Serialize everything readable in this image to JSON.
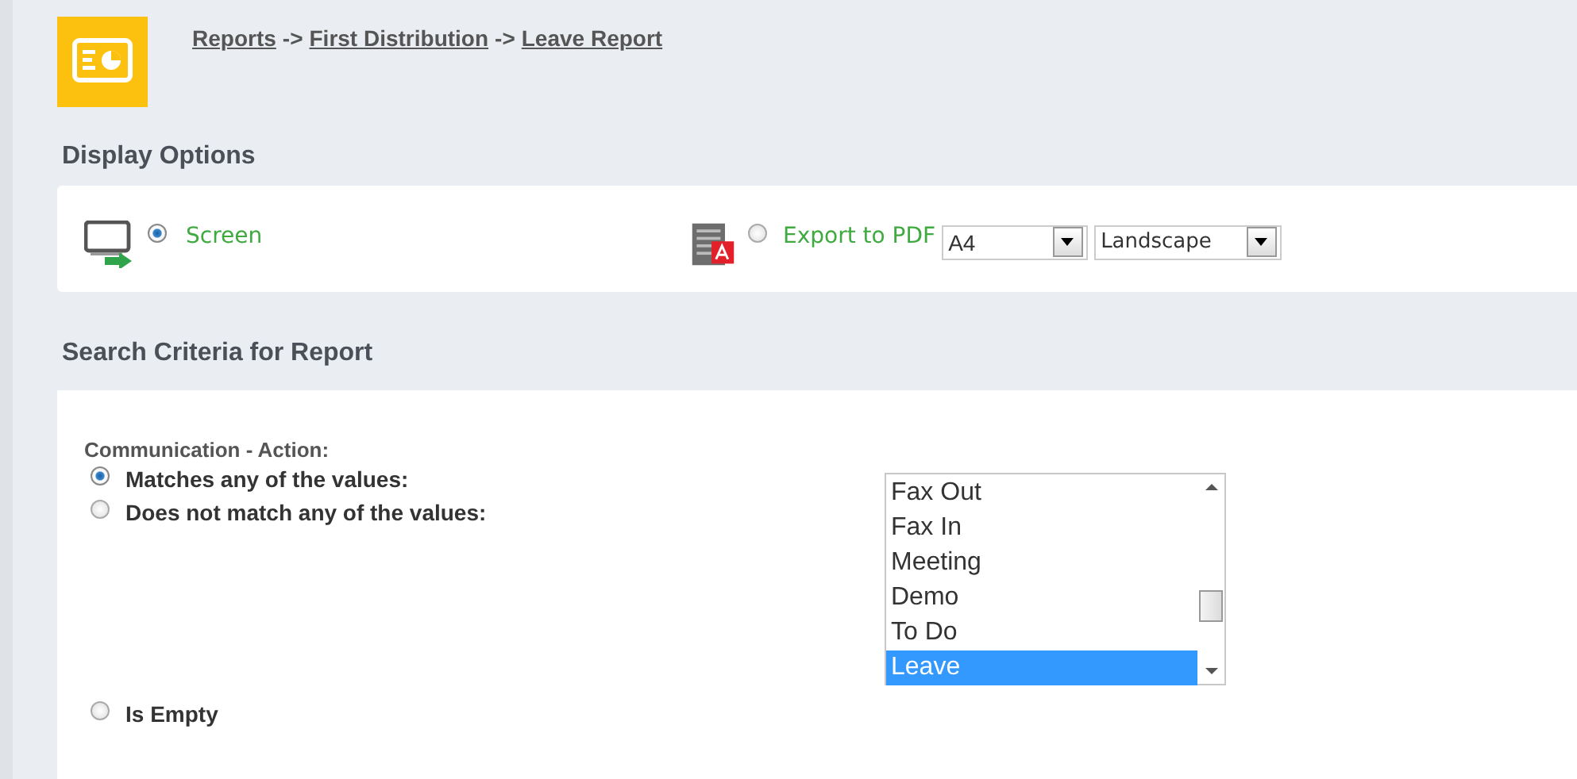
{
  "breadcrumb": [
    {
      "label": "Reports"
    },
    {
      "label": "First Distribution"
    },
    {
      "label": "Leave Report"
    }
  ],
  "breadcrumb_separator": "->",
  "display_options": {
    "title": "Display Options",
    "choices": [
      {
        "kind": "screen",
        "label": "Screen",
        "selected": true
      },
      {
        "kind": "pdf",
        "label": "Export to PDF",
        "selected": false,
        "paper": "A4",
        "orientation": "Landscape"
      }
    ]
  },
  "search_criteria": {
    "title": "Search Criteria for Report",
    "field_label": "Communication - Action:",
    "match_options": [
      {
        "label": "Matches any of the values:",
        "selected": true
      },
      {
        "label": "Does not match any of the values:",
        "selected": false
      }
    ],
    "values": [
      {
        "label": "Fax Out",
        "selected": false
      },
      {
        "label": "Fax In",
        "selected": false
      },
      {
        "label": "Meeting",
        "selected": false
      },
      {
        "label": "Demo",
        "selected": false
      },
      {
        "label": "To Do",
        "selected": false
      },
      {
        "label": "Leave",
        "selected": true
      }
    ],
    "empty_option": {
      "label": "Is Empty",
      "selected": false
    }
  }
}
